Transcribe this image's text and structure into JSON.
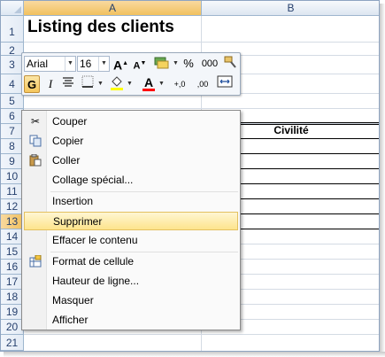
{
  "spreadsheet": {
    "columns": [
      "A",
      "B"
    ],
    "selected_column": "A",
    "rows": [
      "1",
      "2",
      "3",
      "4",
      "5",
      "6",
      "7",
      "8",
      "9",
      "10",
      "11",
      "12",
      "13",
      "14",
      "15",
      "16",
      "17",
      "18",
      "19",
      "20",
      "21"
    ],
    "selected_rows": [
      "13"
    ],
    "cells": {
      "A1": "Listing des clients",
      "B7": "Civilité"
    }
  },
  "mini_toolbar": {
    "font_name": "Arial",
    "font_size": "16",
    "grow_font": "A",
    "shrink_font": "A",
    "percent": "%",
    "thousands": "000",
    "bold": "G",
    "italic": "I",
    "font_color_letter": "A",
    "increase_decimal": "+,0",
    "decrease_decimal": ",00",
    "fill_color": "#ffff00",
    "font_color": "#ff0000"
  },
  "context_menu": {
    "items": [
      {
        "label": "Couper",
        "icon": "scissors-icon"
      },
      {
        "label": "Copier",
        "icon": "copy-icon"
      },
      {
        "label": "Coller",
        "icon": "paste-icon"
      },
      {
        "label": "Collage spécial...",
        "icon": ""
      },
      {
        "label": "Insertion",
        "icon": ""
      },
      {
        "label": "Supprimer",
        "icon": "",
        "highlighted": true
      },
      {
        "label": "Effacer le contenu",
        "icon": ""
      },
      {
        "label": "Format de cellule",
        "icon": "format-cells-icon"
      },
      {
        "label": "Hauteur de ligne...",
        "icon": ""
      },
      {
        "label": "Masquer",
        "icon": ""
      },
      {
        "label": "Afficher",
        "icon": ""
      }
    ]
  },
  "colors": {
    "header_blue": "#27416e",
    "highlight": "#fde48c",
    "grid": "#d4dbe4"
  }
}
